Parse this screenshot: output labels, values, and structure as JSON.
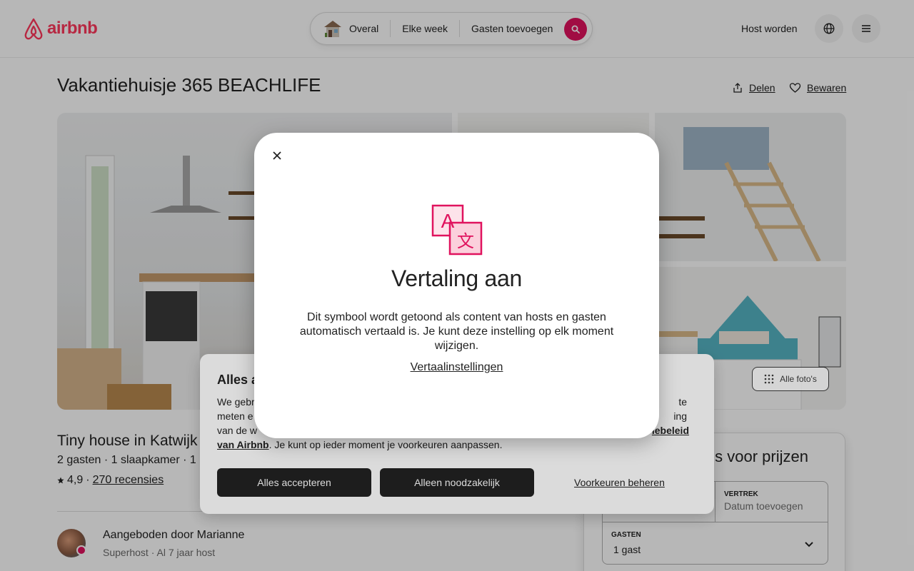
{
  "brand": {
    "name": "airbnb",
    "color": "#ff385c"
  },
  "header": {
    "search": {
      "anywhere": "Overal",
      "week": "Elke week",
      "guests": "Gasten toevoegen"
    },
    "host_link": "Host worden",
    "icons": {
      "globe": "globe-icon",
      "menu": "menu-icon",
      "search": "search-icon"
    }
  },
  "listing": {
    "title": "Vakantiehuisje 365 BEACHLIFE",
    "share": "Delen",
    "save": "Bewaren",
    "all_photos": "Alle foto's",
    "subtitle": "Tiny house in Katwijk",
    "meta": "2 gasten · 1 slaapkamer · 1",
    "rating": "4,9",
    "reviews": "270 recensies",
    "host_title": "Aangeboden door Marianne",
    "host_meta": "Superhost · Al 7 jaar host"
  },
  "booking": {
    "title_visible": "s voor prijzen",
    "checkout_label": "VERTREK",
    "checkout_value": "Datum toevoegen",
    "guests_label": "GASTEN",
    "guests_value": "1 gast"
  },
  "cookie": {
    "title": "Alles a",
    "line1_left": "We gebr",
    "line1_right": "te",
    "line2_left": "meten e",
    "line2_right": "ing",
    "line3_left": "van de w",
    "line3_right": "iebeleid",
    "line4_link": "van Airbnb",
    "line4_rest": ". Je kunt op ieder moment je voorkeuren aanpassen.",
    "accept_all": "Alles accepteren",
    "essential_only": "Alleen noodzakelijk",
    "manage": "Voorkeuren beheren"
  },
  "modal": {
    "title": "Vertaling aan",
    "text": "Dit symbool wordt getoond als content van hosts en gasten automatisch vertaald is. Je kunt deze instelling op elk moment wijzigen.",
    "link": "Vertaalinstellingen",
    "icon_glyph_a": "A",
    "icon_glyph_b": "文",
    "icon_color": "#e0135e"
  }
}
